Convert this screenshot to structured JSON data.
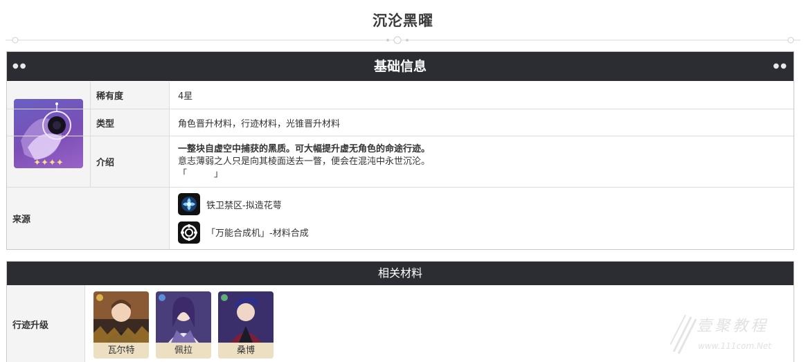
{
  "page": {
    "title": "沉沦黑曜"
  },
  "basic_info": {
    "header": "基础信息",
    "rarity": {
      "label": "稀有度",
      "value": "4星"
    },
    "type": {
      "label": "类型",
      "value": "角色晋升材料，行迹材料，光锥晋升材料"
    },
    "intro": {
      "label": "介绍",
      "line1": "一整块自虚空中捕获的黑质。可大幅提升虚无角色的命途行迹。",
      "line2": "意志薄弱之人只是向其棱面送去一瞥，便会在混沌中永世沉沦。",
      "line3": "「　　　」"
    },
    "source": {
      "label": "来源",
      "items": [
        {
          "icon": "calyx-flower-icon",
          "text": "铁卫禁区-拟造花萼"
        },
        {
          "icon": "synthesizer-icon",
          "text": "「万能合成机」-材料合成"
        }
      ]
    }
  },
  "related": {
    "header": "相关材料",
    "trace_upgrade": {
      "label": "行迹升级",
      "characters": [
        {
          "name": "瓦尔特",
          "element_color": "#d9b24a"
        },
        {
          "name": "佩拉",
          "element_color": "#5a8fd9"
        },
        {
          "name": "桑博",
          "element_color": "#5fae7a"
        }
      ]
    }
  },
  "watermark": {
    "text": "壹聚教程",
    "url": "www.111com.Net"
  },
  "colors": {
    "header_bg": "#2b2d33",
    "label_bg": "#f4f4f4",
    "card_bg": "#ecdfc2"
  }
}
